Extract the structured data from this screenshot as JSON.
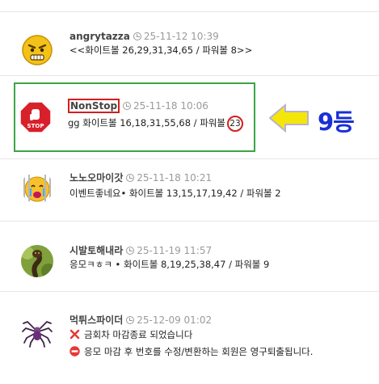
{
  "comments": [
    {
      "nickname": "angrytazza",
      "time": "25-11-12 10:39",
      "text": "<<화이트볼 26,29,31,34,65 / 파워볼 8>>"
    },
    {
      "nickname": "NonStop",
      "time": "25-11-18 10:06",
      "text_prefix": "gg 화이트볼 16,18,31,55,68 / 파워볼",
      "powerball": "23"
    },
    {
      "nickname": "노노오마이갓",
      "time": "25-11-18 10:21",
      "text": "이벤트좋네요• 화이트볼 13,15,17,19,42 / 파워볼 2"
    },
    {
      "nickname": "시발토해내라",
      "time": "25-11-19 11:57",
      "text": "응모ㅋㅎㅋ • 화이트볼 8,19,25,38,47 / 파워볼 9"
    },
    {
      "nickname": "먹튀스파이더",
      "time": "25-12-09 01:02"
    }
  ],
  "notices": {
    "closed": "금회차 마감종료 되었습니다",
    "warning": "응모 마감 후 번호를 수정/변환하는 회원은 영구퇴출됩니다."
  },
  "annotation": {
    "rank_label": "9등"
  },
  "stop_sign_text": "STOP",
  "colors": {
    "highlight_green": "#3aa545",
    "mark_red": "#d21f1f",
    "rank_blue": "#1a2fd6",
    "arrow_yellow": "#f5e60a"
  }
}
